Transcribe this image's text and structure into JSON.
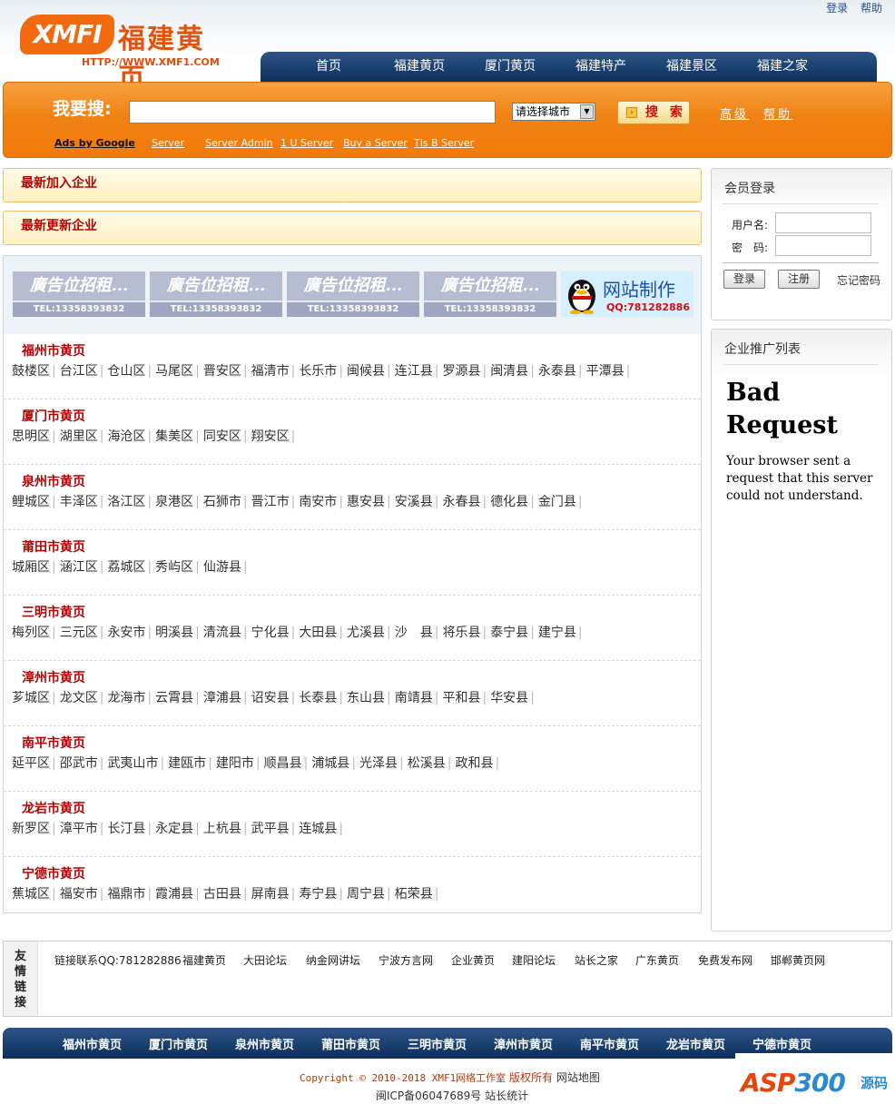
{
  "header": {
    "logo_text": "XMFI",
    "logo_cn": "福建黄页",
    "logo_url": "HTTP://WWW.XMF1.COM",
    "top_links": [
      "登录",
      "帮助"
    ],
    "nav": [
      "首页",
      "福建黄页",
      "厦门黄页",
      "福建特产",
      "福建景区",
      "福建之家"
    ]
  },
  "search": {
    "label": "我要搜:",
    "input_value": "",
    "city_select": "请选择城市",
    "button": "搜 索",
    "advanced": "高级",
    "help": "帮助",
    "ads_by": "Ads by Google",
    "ad_links": [
      "Server",
      "Server Admin",
      "1 U Server",
      "Buy a Server",
      "Tls B Server"
    ]
  },
  "sections": {
    "latest_added": "最新加入企业",
    "latest_updated": "最新更新企业"
  },
  "banners": {
    "ad_text": "廣告位招租...",
    "ad_tel": "TEL:13358393832",
    "qq_title": "网站制作",
    "qq_number": "QQ:781282886"
  },
  "cities": [
    {
      "name": "福州市黄页",
      "districts": [
        "鼓楼区",
        "台江区",
        "仓山区",
        "马尾区",
        "晋安区",
        "福清市",
        "长乐市",
        "闽候县",
        "连江县",
        "罗源县",
        "闽清县",
        "永泰县",
        "平潭县"
      ]
    },
    {
      "name": "厦门市黄页",
      "districts": [
        "思明区",
        "湖里区",
        "海沧区",
        "集美区",
        "同安区",
        "翔安区"
      ]
    },
    {
      "name": "泉州市黄页",
      "districts": [
        "鲤城区",
        "丰泽区",
        "洛江区",
        "泉港区",
        "石狮市",
        "晋江市",
        "南安市",
        "惠安县",
        "安溪县",
        "永春县",
        "德化县",
        "金门县"
      ]
    },
    {
      "name": "莆田市黄页",
      "districts": [
        "城厢区",
        "涵江区",
        "荔城区",
        "秀屿区",
        "仙游县"
      ]
    },
    {
      "name": "三明市黄页",
      "districts": [
        "梅列区",
        "三元区",
        "永安市",
        "明溪县",
        "清流县",
        "宁化县",
        "大田县",
        "尤溪县",
        "沙　县",
        "将乐县",
        "泰宁县",
        "建宁县"
      ]
    },
    {
      "name": "漳州市黄页",
      "districts": [
        "芗城区",
        "龙文区",
        "龙海市",
        "云霄县",
        "漳浦县",
        "诏安县",
        "长泰县",
        "东山县",
        "南靖县",
        "平和县",
        "华安县"
      ]
    },
    {
      "name": "南平市黄页",
      "districts": [
        "延平区",
        "邵武市",
        "武夷山市",
        "建瓯市",
        "建阳市",
        "顺昌县",
        "浦城县",
        "光泽县",
        "松溪县",
        "政和县"
      ]
    },
    {
      "name": "龙岩市黄页",
      "districts": [
        "新罗区",
        "漳平市",
        "长汀县",
        "永定县",
        "上杭县",
        "武平县",
        "连城县"
      ]
    },
    {
      "name": "宁德市黄页",
      "districts": [
        "蕉城区",
        "福安市",
        "福鼎市",
        "霞浦县",
        "古田县",
        "屏南县",
        "寿宁县",
        "周宁县",
        "柘荣县"
      ]
    }
  ],
  "login": {
    "title": "会员登录",
    "username_label": "用户名:",
    "password_label": "密　码:",
    "login_button": "登录",
    "register_button": "注册",
    "forgot": "忘记密码"
  },
  "promo": {
    "title": "企业推广列表",
    "error_heading": "Bad Request",
    "error_text": "Your browser sent a request that this server could not understand."
  },
  "friends": {
    "label": "友情链接",
    "links": [
      "链接联系QQ:781282886",
      "福建黄页",
      "大田论坛",
      "纳金网讲坛",
      "宁波方言网",
      "企业黄页",
      "建阳论坛",
      "站长之家",
      "广东黄页",
      "免费发布网",
      "邯郸黄页网"
    ]
  },
  "bottom_nav": [
    "福州市黄页",
    "厦门市黄页",
    "泉州市黄页",
    "莆田市黄页",
    "三明市黄页",
    "漳州市黄页",
    "南平市黄页",
    "龙岩市黄页",
    "宁德市黄页"
  ],
  "footer": {
    "copyright": "Copyright © 2010-2018 XMF1网络工作室",
    "rights": "版权所有",
    "sitemap": "网站地图",
    "icp": "闽ICP备06047689号",
    "stats": "站长统计"
  },
  "watermark": {
    "asp": "ASP",
    "num": "300",
    "cn": "源码"
  }
}
